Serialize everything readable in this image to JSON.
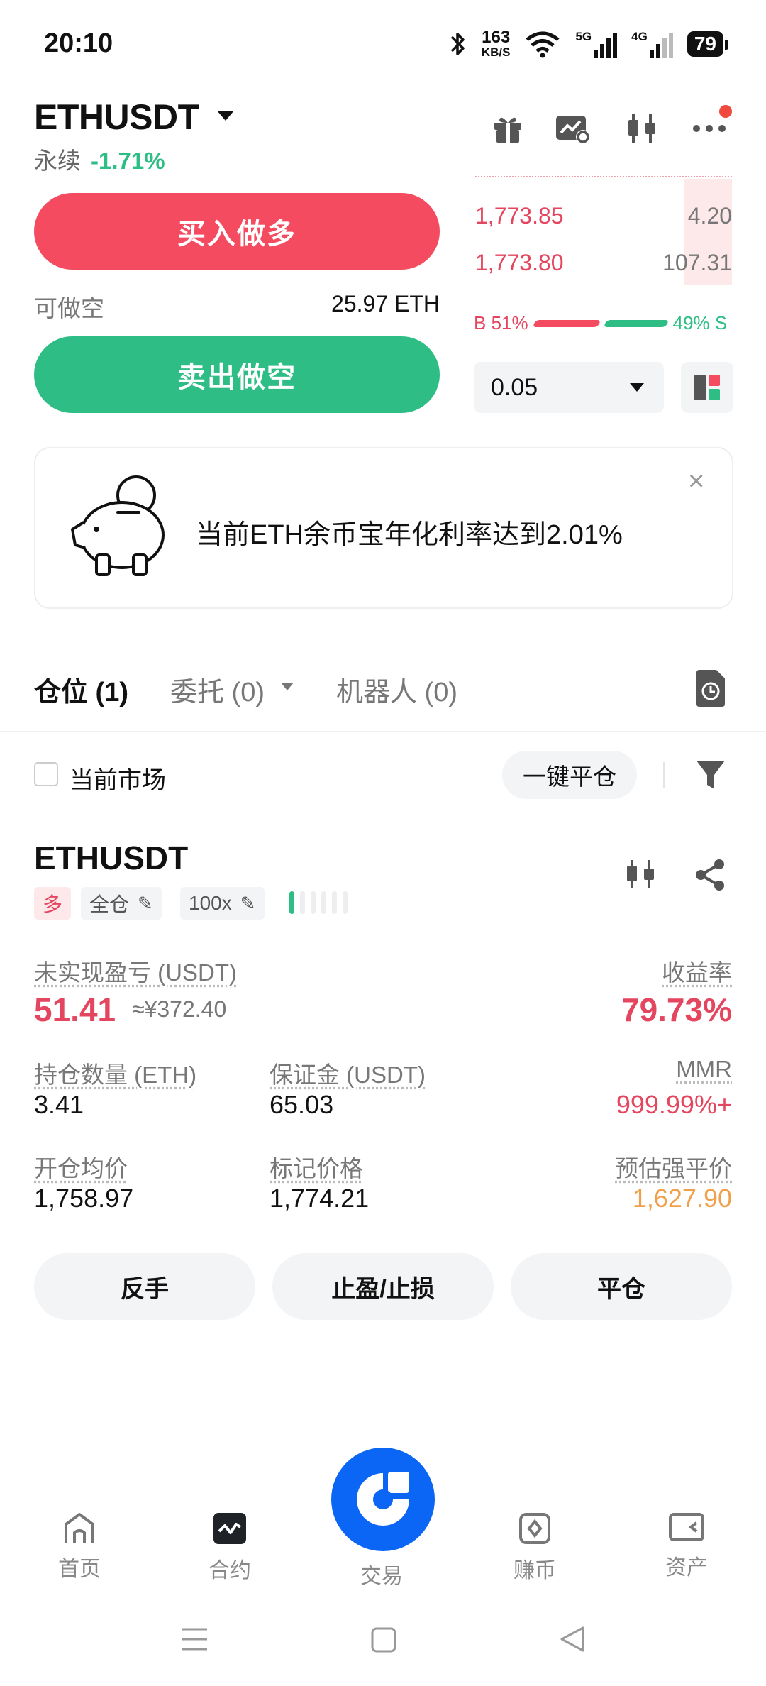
{
  "status_bar": {
    "time": "20:10",
    "net_speed_value": "163",
    "net_speed_unit": "KB/S",
    "signal_1": "5G",
    "signal_2": "4G",
    "battery": "79"
  },
  "header": {
    "symbol": "ETHUSDT",
    "contract_type": "永续",
    "change": "-1.71%",
    "icons": [
      "gift-icon",
      "chart-settings-icon",
      "candlestick-icon",
      "more-icon"
    ]
  },
  "order_book": {
    "rows": [
      {
        "price": "1,773.85",
        "qty": "4.20"
      },
      {
        "price": "1,773.80",
        "qty": "107.31"
      }
    ],
    "buy_ratio_label": "B 51%",
    "sell_ratio_label": "49% S",
    "buy_ratio": 0.51
  },
  "trade": {
    "buy_label": "买入做多",
    "sell_label": "卖出做空",
    "avail_short_label": "可做空",
    "avail_short_value": "25.97 ETH",
    "qty_value": "0.05"
  },
  "promo": {
    "text": "当前ETH余币宝年化利率达到2.01%",
    "close": "×"
  },
  "tabs": {
    "positions": "仓位 (1)",
    "orders": "委托 (0)",
    "bots": "机器人 (0)"
  },
  "filters": {
    "current_market": "当前市场",
    "close_all": "一键平仓"
  },
  "position": {
    "symbol": "ETHUSDT",
    "side": "多",
    "margin_mode": "全仓",
    "leverage": "100x",
    "leverage_level": 1,
    "unrealized_pnl_label": "未实现盈亏 (USDT)",
    "unrealized_pnl": "51.41",
    "unrealized_pnl_cny": "≈¥372.40",
    "roe_label": "收益率",
    "roe": "79.73%",
    "size_label": "持仓数量 (ETH)",
    "size": "3.41",
    "margin_label": "保证金 (USDT)",
    "margin": "65.03",
    "mmr_label": "MMR",
    "mmr": "999.99%+",
    "entry_label": "开仓均价",
    "entry": "1,758.97",
    "mark_label": "标记价格",
    "mark": "1,774.21",
    "liq_label": "预估强平价",
    "liq": "1,627.90",
    "reverse": "反手",
    "tp_sl": "止盈/止损",
    "close": "平仓"
  },
  "bottom_nav": {
    "home": "首页",
    "contract": "合约",
    "trade": "交易",
    "earn": "赚币",
    "assets": "资产"
  },
  "colors": {
    "red": "#f44b61",
    "green": "#2ebd85",
    "orange": "#f0a04b",
    "blue": "#0b66f5"
  }
}
